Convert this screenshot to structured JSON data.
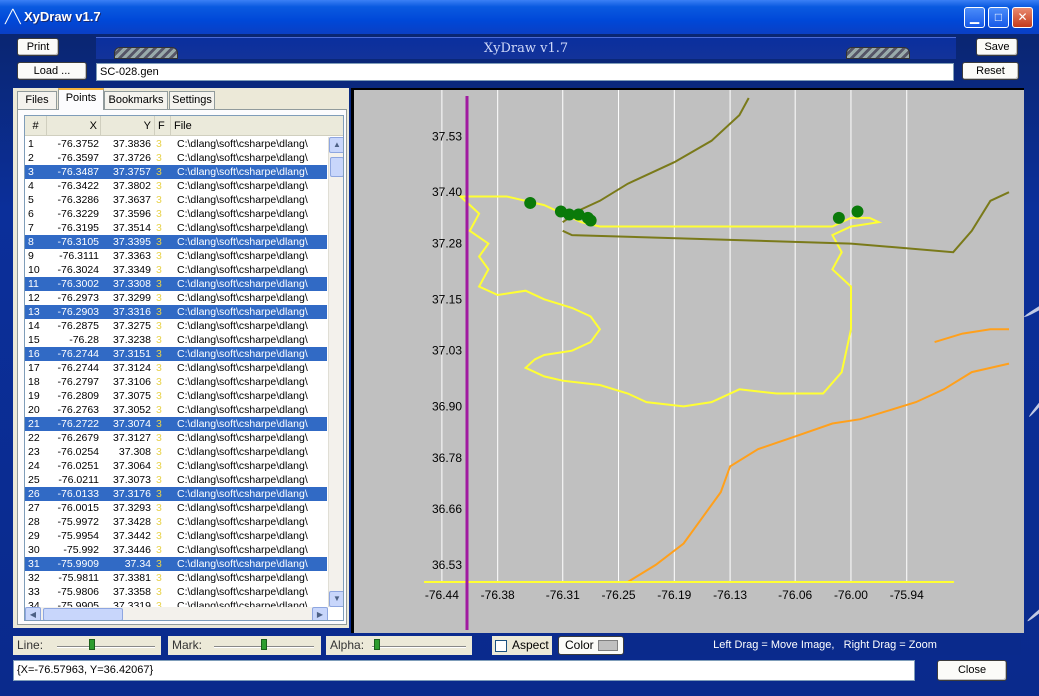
{
  "window": {
    "title": "XyDraw v1.7",
    "icon": "chart-line-icon"
  },
  "header": {
    "title": "XyDraw v1.7",
    "file_name": "SC-028.gen"
  },
  "buttons": {
    "print": "Print",
    "load": "Load ...",
    "save": "Save",
    "reset": "Reset",
    "close": "Close",
    "color": "Color"
  },
  "tabs": [
    {
      "label": "Files",
      "active": false
    },
    {
      "label": "Points",
      "active": true
    },
    {
      "label": "Bookmarks",
      "active": false
    },
    {
      "label": "Settings",
      "active": false
    }
  ],
  "table": {
    "columns": [
      "#",
      "X",
      "Y",
      "F",
      "File"
    ],
    "rows": [
      {
        "id": "1",
        "x": "-76.3752",
        "y": "37.3836",
        "f": "3",
        "file": "C:\\dlang\\soft\\csharpe\\dlang\\",
        "sel": false
      },
      {
        "id": "2",
        "x": "-76.3597",
        "y": "37.3726",
        "f": "3",
        "file": "C:\\dlang\\soft\\csharpe\\dlang\\",
        "sel": false
      },
      {
        "id": "3",
        "x": "-76.3487",
        "y": "37.3757",
        "f": "3",
        "file": "C:\\dlang\\soft\\csharpe\\dlang\\",
        "sel": true
      },
      {
        "id": "4",
        "x": "-76.3422",
        "y": "37.3802",
        "f": "3",
        "file": "C:\\dlang\\soft\\csharpe\\dlang\\",
        "sel": false
      },
      {
        "id": "5",
        "x": "-76.3286",
        "y": "37.3637",
        "f": "3",
        "file": "C:\\dlang\\soft\\csharpe\\dlang\\",
        "sel": false
      },
      {
        "id": "6",
        "x": "-76.3229",
        "y": "37.3596",
        "f": "3",
        "file": "C:\\dlang\\soft\\csharpe\\dlang\\",
        "sel": false
      },
      {
        "id": "7",
        "x": "-76.3195",
        "y": "37.3514",
        "f": "3",
        "file": "C:\\dlang\\soft\\csharpe\\dlang\\",
        "sel": false
      },
      {
        "id": "8",
        "x": "-76.3105",
        "y": "37.3395",
        "f": "3",
        "file": "C:\\dlang\\soft\\csharpe\\dlang\\",
        "sel": true
      },
      {
        "id": "9",
        "x": "-76.3111",
        "y": "37.3363",
        "f": "3",
        "file": "C:\\dlang\\soft\\csharpe\\dlang\\",
        "sel": false
      },
      {
        "id": "10",
        "x": "-76.3024",
        "y": "37.3349",
        "f": "3",
        "file": "C:\\dlang\\soft\\csharpe\\dlang\\",
        "sel": false
      },
      {
        "id": "11",
        "x": "-76.3002",
        "y": "37.3308",
        "f": "3",
        "file": "C:\\dlang\\soft\\csharpe\\dlang\\",
        "sel": true
      },
      {
        "id": "12",
        "x": "-76.2973",
        "y": "37.3299",
        "f": "3",
        "file": "C:\\dlang\\soft\\csharpe\\dlang\\",
        "sel": false
      },
      {
        "id": "13",
        "x": "-76.2903",
        "y": "37.3316",
        "f": "3",
        "file": "C:\\dlang\\soft\\csharpe\\dlang\\",
        "sel": true
      },
      {
        "id": "14",
        "x": "-76.2875",
        "y": "37.3275",
        "f": "3",
        "file": "C:\\dlang\\soft\\csharpe\\dlang\\",
        "sel": false
      },
      {
        "id": "15",
        "x": "-76.28",
        "y": "37.3238",
        "f": "3",
        "file": "C:\\dlang\\soft\\csharpe\\dlang\\",
        "sel": false
      },
      {
        "id": "16",
        "x": "-76.2744",
        "y": "37.3151",
        "f": "3",
        "file": "C:\\dlang\\soft\\csharpe\\dlang\\",
        "sel": true
      },
      {
        "id": "17",
        "x": "-76.2744",
        "y": "37.3124",
        "f": "3",
        "file": "C:\\dlang\\soft\\csharpe\\dlang\\",
        "sel": false
      },
      {
        "id": "18",
        "x": "-76.2797",
        "y": "37.3106",
        "f": "3",
        "file": "C:\\dlang\\soft\\csharpe\\dlang\\",
        "sel": false
      },
      {
        "id": "19",
        "x": "-76.2809",
        "y": "37.3075",
        "f": "3",
        "file": "C:\\dlang\\soft\\csharpe\\dlang\\",
        "sel": false
      },
      {
        "id": "20",
        "x": "-76.2763",
        "y": "37.3052",
        "f": "3",
        "file": "C:\\dlang\\soft\\csharpe\\dlang\\",
        "sel": false
      },
      {
        "id": "21",
        "x": "-76.2722",
        "y": "37.3074",
        "f": "3",
        "file": "C:\\dlang\\soft\\csharpe\\dlang\\",
        "sel": true
      },
      {
        "id": "22",
        "x": "-76.2679",
        "y": "37.3127",
        "f": "3",
        "file": "C:\\dlang\\soft\\csharpe\\dlang\\",
        "sel": false
      },
      {
        "id": "23",
        "x": "-76.0254",
        "y": "37.308",
        "f": "3",
        "file": "C:\\dlang\\soft\\csharpe\\dlang\\",
        "sel": false
      },
      {
        "id": "24",
        "x": "-76.0251",
        "y": "37.3064",
        "f": "3",
        "file": "C:\\dlang\\soft\\csharpe\\dlang\\",
        "sel": false
      },
      {
        "id": "25",
        "x": "-76.0211",
        "y": "37.3073",
        "f": "3",
        "file": "C:\\dlang\\soft\\csharpe\\dlang\\",
        "sel": false
      },
      {
        "id": "26",
        "x": "-76.0133",
        "y": "37.3176",
        "f": "3",
        "file": "C:\\dlang\\soft\\csharpe\\dlang\\",
        "sel": true
      },
      {
        "id": "27",
        "x": "-76.0015",
        "y": "37.3293",
        "f": "3",
        "file": "C:\\dlang\\soft\\csharpe\\dlang\\",
        "sel": false
      },
      {
        "id": "28",
        "x": "-75.9972",
        "y": "37.3428",
        "f": "3",
        "file": "C:\\dlang\\soft\\csharpe\\dlang\\",
        "sel": false
      },
      {
        "id": "29",
        "x": "-75.9954",
        "y": "37.3442",
        "f": "3",
        "file": "C:\\dlang\\soft\\csharpe\\dlang\\",
        "sel": false
      },
      {
        "id": "30",
        "x": "-75.992",
        "y": "37.3446",
        "f": "3",
        "file": "C:\\dlang\\soft\\csharpe\\dlang\\",
        "sel": false
      },
      {
        "id": "31",
        "x": "-75.9909",
        "y": "37.34",
        "f": "3",
        "file": "C:\\dlang\\soft\\csharpe\\dlang\\",
        "sel": true
      },
      {
        "id": "32",
        "x": "-75.9811",
        "y": "37.3381",
        "f": "3",
        "file": "C:\\dlang\\soft\\csharpe\\dlang\\",
        "sel": false
      },
      {
        "id": "33",
        "x": "-75.9806",
        "y": "37.3358",
        "f": "3",
        "file": "C:\\dlang\\soft\\csharpe\\dlang\\",
        "sel": false
      },
      {
        "id": "34",
        "x": "-75.9905",
        "y": "37.3319",
        "f": "3",
        "file": "C:\\dlang\\soft\\csharpe\\dlang\\",
        "sel": false
      }
    ]
  },
  "controls": {
    "line_label": "Line:",
    "mark_label": "Mark:",
    "alpha_label": "Alpha:",
    "aspect_label": "Aspect",
    "aspect_checked": false,
    "hint": "Left Drag = Move Image,   Right Drag = Zoom",
    "line_slider_fraction": 0.35,
    "mark_slider_fraction": 0.5,
    "alpha_slider_fraction": 0.02
  },
  "status": {
    "coords": "{X=-76.57963, Y=36.42067}"
  },
  "colors": {
    "selection": "#316ac5",
    "plot_background": "#c0c0c0",
    "coast_yellow": "#ffff33",
    "olive_track": "#7a7a1a",
    "orange_track": "#ffa01c",
    "marker_green": "#0a7a0a",
    "axis_magenta": "#a01aa0"
  },
  "chart_data": {
    "type": "line",
    "x_ticks": [
      "-76.44",
      "-76.38",
      "-76.31",
      "-76.25",
      "-76.19",
      "-76.13",
      "-76.06",
      "-76.00",
      "-75.94"
    ],
    "y_ticks": [
      "37.53",
      "37.40",
      "37.28",
      "37.15",
      "37.03",
      "36.90",
      "36.78",
      "36.66",
      "36.53"
    ],
    "xlim": [
      -76.47,
      -75.83
    ],
    "ylim": [
      36.49,
      37.62
    ],
    "grid": "vertical",
    "series": [
      {
        "role": "coastline",
        "color": "#ffff33",
        "points": [
          [
            -76.37,
            37.39
          ],
          [
            -76.33,
            37.37
          ],
          [
            -76.32,
            37.36
          ],
          [
            -76.31,
            37.35
          ],
          [
            -76.3,
            37.34
          ],
          [
            -76.29,
            37.33
          ],
          [
            -76.27,
            37.32
          ],
          [
            -76.25,
            37.32
          ],
          [
            -76.2,
            37.32
          ],
          [
            -76.15,
            37.32
          ],
          [
            -76.1,
            37.32
          ],
          [
            -76.05,
            37.32
          ],
          [
            -76.02,
            37.32
          ],
          [
            -76.0,
            37.34
          ],
          [
            -75.98,
            37.34
          ],
          [
            -75.97,
            37.33
          ],
          [
            -76.0,
            37.32
          ],
          [
            -76.02,
            37.3
          ],
          [
            -76.01,
            37.26
          ],
          [
            -76.02,
            37.22
          ],
          [
            -76.0,
            37.18
          ],
          [
            -76.0,
            37.08
          ],
          [
            -76.01,
            36.98
          ],
          [
            -76.03,
            36.93
          ],
          [
            -76.08,
            36.93
          ],
          [
            -76.12,
            36.94
          ],
          [
            -76.15,
            36.91
          ],
          [
            -76.18,
            36.9
          ],
          [
            -76.22,
            36.91
          ],
          [
            -76.24,
            36.93
          ],
          [
            -76.27,
            36.95
          ],
          [
            -76.31,
            36.96
          ],
          [
            -76.33,
            36.97
          ],
          [
            -76.35,
            36.99
          ],
          [
            -76.34,
            37.01
          ],
          [
            -76.33,
            37.02
          ],
          [
            -76.3,
            37.03
          ],
          [
            -76.28,
            37.05
          ],
          [
            -76.27,
            37.08
          ],
          [
            -76.28,
            37.11
          ],
          [
            -76.3,
            37.13
          ],
          [
            -76.33,
            37.15
          ],
          [
            -76.35,
            37.17
          ],
          [
            -76.38,
            37.16
          ],
          [
            -76.4,
            37.18
          ],
          [
            -76.39,
            37.22
          ],
          [
            -76.4,
            37.25
          ],
          [
            -76.39,
            37.28
          ],
          [
            -76.41,
            37.31
          ],
          [
            -76.4,
            37.35
          ],
          [
            -76.42,
            37.39
          ],
          [
            -76.37,
            37.39
          ]
        ]
      },
      {
        "role": "track-olive",
        "color": "#7a7a1a",
        "points": [
          [
            -76.31,
            37.31
          ],
          [
            -76.3,
            37.3
          ],
          [
            -76.0,
            37.28
          ],
          [
            -75.89,
            37.26
          ],
          [
            -75.87,
            37.31
          ],
          [
            -75.85,
            37.38
          ],
          [
            -75.83,
            37.4
          ]
        ]
      },
      {
        "role": "track-olive-north",
        "color": "#7a7a1a",
        "points": [
          [
            -76.31,
            37.33
          ],
          [
            -76.29,
            37.36
          ],
          [
            -76.27,
            37.38
          ],
          [
            -76.24,
            37.42
          ],
          [
            -76.19,
            37.47
          ],
          [
            -76.15,
            37.52
          ],
          [
            -76.12,
            37.58
          ],
          [
            -76.11,
            37.62
          ]
        ]
      },
      {
        "role": "track-orange",
        "color": "#ffa01c",
        "points": [
          [
            -76.24,
            36.49
          ],
          [
            -76.21,
            36.53
          ],
          [
            -76.18,
            36.58
          ],
          [
            -76.16,
            36.64
          ],
          [
            -76.14,
            36.7
          ],
          [
            -76.13,
            36.76
          ],
          [
            -76.1,
            36.8
          ],
          [
            -76.06,
            36.83
          ],
          [
            -76.02,
            36.86
          ],
          [
            -75.99,
            36.87
          ],
          [
            -75.96,
            36.89
          ],
          [
            -75.93,
            36.91
          ],
          [
            -75.9,
            36.94
          ],
          [
            -75.87,
            36.98
          ],
          [
            -75.83,
            37.0
          ]
        ]
      },
      {
        "role": "track-orange-east",
        "color": "#ffa01c",
        "points": [
          [
            -75.91,
            37.05
          ],
          [
            -75.88,
            37.07
          ],
          [
            -75.85,
            37.08
          ],
          [
            -75.83,
            37.08
          ]
        ]
      },
      {
        "role": "markers",
        "color": "#0a7a0a",
        "points": [
          [
            -76.345,
            37.375
          ],
          [
            -76.312,
            37.355
          ],
          [
            -76.303,
            37.348
          ],
          [
            -76.293,
            37.348
          ],
          [
            -76.283,
            37.34
          ],
          [
            -76.28,
            37.334
          ],
          [
            -76.013,
            37.34
          ],
          [
            -75.993,
            37.355
          ]
        ]
      }
    ]
  }
}
